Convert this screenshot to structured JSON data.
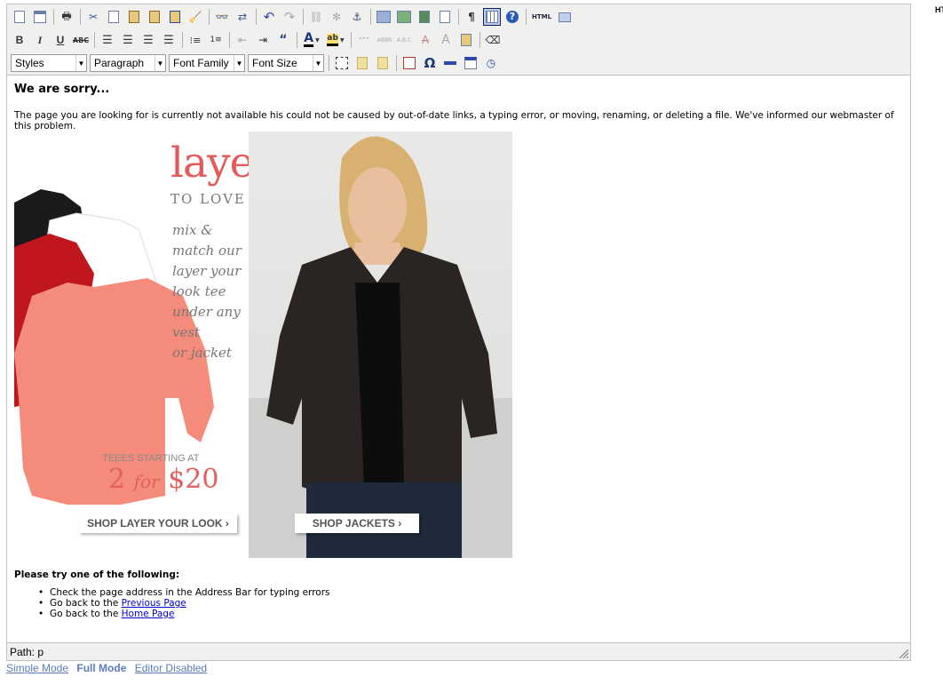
{
  "toolbar": {
    "styles_select": "Styles",
    "format_select": "Paragraph",
    "font_family_select": "Font Family",
    "font_size_select": "Font Size",
    "html_button": "HTML"
  },
  "content": {
    "heading": "We are sorry...",
    "message": "The page you are looking for is currently not available his could not be caused by out-of-date links, a typing error, or moving, renaming, or deleting a file. We've informed our webmaster of this problem.",
    "promo": {
      "title": "layers",
      "subtitle": "TO LOVE",
      "lines": [
        "mix & match our",
        "layer your look tee",
        "under any vest",
        "or jacket"
      ],
      "tees_label": "TEEES STARTING AT",
      "price_count": "2",
      "price_for": "for",
      "price_value": "$20",
      "shop_layer": "SHOP LAYER YOUR LOOK ›",
      "shop_jackets": "SHOP JACKETS ›"
    },
    "try_heading": "Please try one of the following:",
    "options": [
      {
        "text": "Check the page address in the Address Bar for typing errors",
        "link": ""
      },
      {
        "text": "Go back to the ",
        "link": "Previous Page"
      },
      {
        "text": "Go back to the ",
        "link": "Home Page"
      }
    ]
  },
  "statusbar": {
    "path": "Path: p"
  },
  "modes": {
    "simple": "Simple Mode",
    "full": "Full Mode",
    "disabled": "Editor Disabled"
  },
  "corner_text": "HT"
}
